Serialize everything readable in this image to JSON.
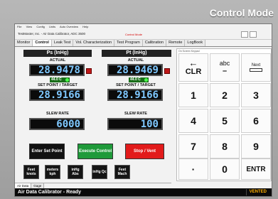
{
  "page_title": "Control Mode",
  "menu": [
    "File",
    "View",
    "Config",
    "Units",
    "Auto Overview",
    "Help"
  ],
  "app_caption": "TestMaster, Inc. - Air Data Calibrator, ADC 3500",
  "control_mode_label": "Control Mode",
  "tabs": [
    {
      "label": "Monitor",
      "active": false
    },
    {
      "label": "Control",
      "active": true
    },
    {
      "label": "Leak Test",
      "active": false
    },
    {
      "label": "Vol. Characterization",
      "active": false
    },
    {
      "label": "Test Program",
      "active": false
    },
    {
      "label": "Calibration",
      "active": false
    },
    {
      "label": "Remote",
      "active": false
    },
    {
      "label": "LogBook",
      "active": false
    }
  ],
  "ps": {
    "header": "Ps (InHg)",
    "actual_label": "ACTUAL",
    "actual": "28.9478",
    "temp": "44.0 C",
    "setpoint_label": "SET POINT / TARGET",
    "setpoint": "28.9166",
    "slew_label": "SLEW RATE",
    "slew": "6000"
  },
  "pt": {
    "header": "Pt (InHg)",
    "actual_label": "ACTUAL",
    "actual": "28.9469",
    "temp": "44.0 C",
    "setpoint_label": "SET POINT / TARGET",
    "setpoint": "28.9166",
    "slew_label": "SLEW RATE",
    "slew": "100"
  },
  "buttons": {
    "enter_setpoint": "Enter Set Point",
    "execute_control": "Execute Control",
    "stop_vent": "Stop / Vent"
  },
  "units": [
    {
      "label": "Feet knots"
    },
    {
      "label": "meters kph"
    },
    {
      "label": "inHg Abs"
    },
    {
      "label": "inHg Qc"
    },
    {
      "label": "Feet Mach"
    }
  ],
  "bottom_tabs": [
    {
      "label": "Air Data",
      "active": true
    },
    {
      "label": "Gage",
      "active": false
    }
  ],
  "status": {
    "text": "Air Data Calibrator - Ready",
    "state": "VENTED"
  },
  "keypad": {
    "label": "On Screen Keypad",
    "clr": "CLR",
    "abc": "abc",
    "dash": "–",
    "next": "Next",
    "keys": [
      "1",
      "2",
      "3",
      "4",
      "5",
      "6",
      "7",
      "8",
      "9",
      "·",
      "0",
      "ENTR"
    ]
  },
  "colors": {
    "lcd_text": "#7fc8ff",
    "execute_green": "#1f9a3a",
    "stop_red": "#e21b1b",
    "temp_green": "#1a6e1a",
    "status_vented": "#ffb000"
  }
}
